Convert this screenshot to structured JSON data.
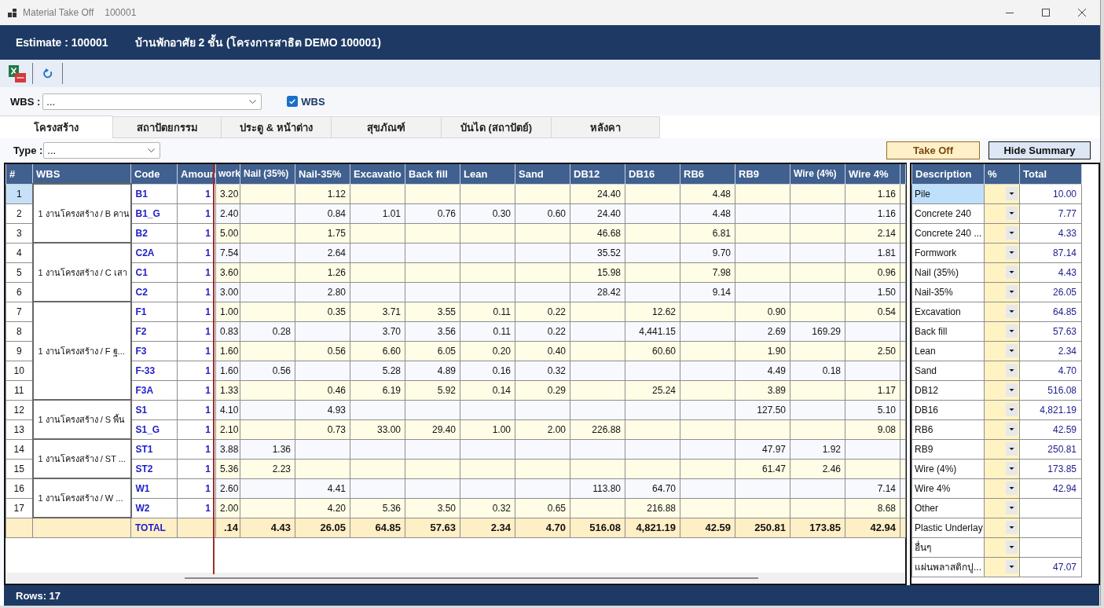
{
  "window": {
    "title": "Material Take Off",
    "document_number": "100001"
  },
  "header": {
    "estimate": "Estimate : 100001",
    "project": "บ้านพักอาศัย 2 ชั้น (โครงการสาธิต DEMO 100001)"
  },
  "filter": {
    "label": "WBS :",
    "value": "...",
    "checkbox": {
      "label": "WBS",
      "checked": true
    }
  },
  "tabs": [
    {
      "label": "โครงสร้าง",
      "selected": true
    },
    {
      "label": "สถาปัตยกรรม",
      "selected": false
    },
    {
      "label": "ประตู & หน้าต่าง",
      "selected": false
    },
    {
      "label": "สุขภัณฑ์",
      "selected": false
    },
    {
      "label": "บันได (สถาปัตย์)",
      "selected": false
    },
    {
      "label": "หลังคา",
      "selected": false
    }
  ],
  "type_filter": {
    "label": "Type :",
    "value": "..."
  },
  "actions": [
    {
      "label": "Take Off",
      "kind": "accent"
    },
    {
      "label": "Hide Summary",
      "kind": "plain"
    }
  ],
  "table": {
    "columns": [
      "#",
      "WBS",
      "Code",
      "Amoun",
      "work",
      "Nail (35%)",
      "Nail-35%",
      "Excavatio",
      "Back fill",
      "Lean",
      "Sand",
      "DB12",
      "DB16",
      "RB6",
      "RB9",
      "Wire (4%)",
      "Wire 4%"
    ],
    "groups": [
      {
        "wbs": "1 งานโครงสร้าง / B คาน",
        "rows": [
          {
            "number": "1",
            "selected": true,
            "code": "B1",
            "amount": "1",
            "quantities": {
              "column_5": "3.20",
              "nail_35": "1.12",
              "db12": "24.40",
              "rb6": "4.48",
              "wire_4": "1.16"
            }
          },
          {
            "number": "2",
            "selected": false,
            "code": "B1_G",
            "amount": "1",
            "quantities": {
              "column_5": "2.40",
              "nail_35": "0.84",
              "excavation": "1.01",
              "back_fill": "0.76",
              "lean": "0.30",
              "sand": "0.60",
              "db12": "24.40",
              "rb6": "4.48",
              "wire_4": "1.16"
            }
          },
          {
            "number": "3",
            "selected": false,
            "code": "B2",
            "amount": "1",
            "quantities": {
              "column_5": "5.00",
              "nail_35": "1.75",
              "db12": "46.68",
              "rb6": "6.81",
              "wire_4": "2.14"
            }
          }
        ]
      },
      {
        "wbs": "1 งานโครงสร้าง / C เสา",
        "rows": [
          {
            "number": "4",
            "selected": false,
            "code": "C2A",
            "amount": "1",
            "quantities": {
              "column_5": "7.54",
              "nail_35": "2.64",
              "db12": "35.52",
              "rb6": "9.70",
              "wire_4": "1.81"
            }
          },
          {
            "number": "5",
            "selected": false,
            "code": "C1",
            "amount": "1",
            "quantities": {
              "column_5": "3.60",
              "nail_35": "1.26",
              "db12": "15.98",
              "rb6": "7.98",
              "wire_4": "0.96"
            }
          },
          {
            "number": "6",
            "selected": false,
            "code": "C2",
            "amount": "1",
            "quantities": {
              "column_5": "3.00",
              "nail_35": "2.80",
              "db12": "28.42",
              "rb6": "9.14",
              "wire_4": "1.50"
            }
          }
        ]
      },
      {
        "wbs": "1 งานโครงสร้าง / F ฐ...",
        "rows": [
          {
            "number": "7",
            "selected": false,
            "code": "F1",
            "amount": "1",
            "quantities": {
              "column_5": "1.00",
              "nail_35": "0.35",
              "excavation": "3.71",
              "back_fill": "3.55",
              "lean": "0.11",
              "sand": "0.22",
              "db16": "12.62",
              "rb9": "0.90",
              "wire_4": "0.54"
            }
          },
          {
            "number": "8",
            "selected": false,
            "code": "F2",
            "amount": "1",
            "quantities": {
              "column_5": "0.83",
              "nail_35_bracketed": "0.28",
              "excavation": "3.70",
              "back_fill": "3.56",
              "lean": "0.11",
              "sand": "0.22",
              "db16": "4,441.15",
              "rb9": "2.69",
              "wire_4_bracketed": "169.29"
            }
          },
          {
            "number": "9",
            "selected": false,
            "code": "F3",
            "amount": "1",
            "quantities": {
              "column_5": "1.60",
              "nail_35": "0.56",
              "excavation": "6.60",
              "back_fill": "6.05",
              "lean": "0.20",
              "sand": "0.40",
              "db16": "60.60",
              "rb9": "1.90",
              "wire_4": "2.50"
            }
          },
          {
            "number": "10",
            "selected": false,
            "code": "F-33",
            "amount": "1",
            "quantities": {
              "column_5": "1.60",
              "nail_35_bracketed": "0.56",
              "excavation": "5.28",
              "back_fill": "4.89",
              "lean": "0.16",
              "sand": "0.32",
              "rb9": "4.49",
              "wire_4_bracketed": "0.18"
            }
          },
          {
            "number": "11",
            "selected": false,
            "code": "F3A",
            "amount": "1",
            "quantities": {
              "column_5": "1.33",
              "nail_35": "0.46",
              "excavation": "6.19",
              "back_fill": "5.92",
              "lean": "0.14",
              "sand": "0.29",
              "db16": "25.24",
              "rb9": "3.89",
              "wire_4": "1.17"
            }
          }
        ]
      },
      {
        "wbs": "1 งานโครงสร้าง / S พื้น",
        "rows": [
          {
            "number": "12",
            "selected": false,
            "code": "S1",
            "amount": "1",
            "quantities": {
              "column_5": "4.10",
              "nail_35": "4.93",
              "rb9": "127.50",
              "wire_4": "5.10"
            }
          },
          {
            "number": "13",
            "selected": false,
            "code": "S1_G",
            "amount": "1",
            "quantities": {
              "column_5": "2.10",
              "nail_35": "0.73",
              "excavation": "33.00",
              "back_fill": "29.40",
              "lean": "1.00",
              "sand": "2.00",
              "db12": "226.88",
              "wire_4": "9.08"
            }
          }
        ]
      },
      {
        "wbs": "1 งานโครงสร้าง / ST ...",
        "rows": [
          {
            "number": "14",
            "selected": false,
            "code": "ST1",
            "amount": "1",
            "quantities": {
              "column_5": "3.88",
              "nail_35_bracketed": "1.36",
              "rb9": "47.97",
              "wire_4_bracketed": "1.92"
            }
          },
          {
            "number": "15",
            "selected": false,
            "code": "ST2",
            "amount": "1",
            "quantities": {
              "column_5": "5.36",
              "nail_35_bracketed": "2.23",
              "rb9": "61.47",
              "wire_4_bracketed": "2.46"
            }
          }
        ]
      },
      {
        "wbs": "1 งานโครงสร้าง / W ...",
        "rows": [
          {
            "number": "16",
            "selected": false,
            "code": "W1",
            "amount": "1",
            "quantities": {
              "column_5": "2.60",
              "nail_35": "4.41",
              "db12": "113.80",
              "db16": "64.70",
              "wire_4": "7.14"
            }
          },
          {
            "number": "17",
            "selected": false,
            "code": "W2",
            "amount": "1",
            "quantities": {
              "column_5": "2.00",
              "nail_35": "4.20",
              "excavation": "5.36",
              "back_fill": "3.50",
              "lean": "0.32",
              "sand": "0.65",
              "db16": "216.88",
              "wire_4": "8.68"
            }
          }
        ]
      }
    ],
    "total": {
      "label": "TOTAL",
      "quantities": {
        "column_5": ".14",
        "nail_35_bracketed": "4.43",
        "nail_35": "26.05",
        "excavation": "64.85",
        "back_fill": "57.63",
        "lean": "2.34",
        "sand": "4.70",
        "db12": "516.08",
        "db16": "4,821.19",
        "rb6": "42.59",
        "rb9": "250.81",
        "wire_4_bracketed": "173.85",
        "wire_4": "42.94"
      }
    }
  },
  "summary": {
    "columns": [
      "Description",
      "%",
      "Total"
    ],
    "rows": [
      {
        "description": "Pile",
        "selected": true,
        "total": "10.00"
      },
      {
        "description": "Concrete 240",
        "selected": false,
        "total": "7.77"
      },
      {
        "description": "Concrete 240 ...",
        "selected": false,
        "total": "4.33"
      },
      {
        "description": "Formwork",
        "selected": false,
        "total": "87.14"
      },
      {
        "description": "Nail (35%)",
        "selected": false,
        "total": "4.43"
      },
      {
        "description": "Nail-35%",
        "selected": false,
        "total": "26.05"
      },
      {
        "description": "Excavation",
        "selected": false,
        "total": "64.85"
      },
      {
        "description": "Back fill",
        "selected": false,
        "total": "57.63"
      },
      {
        "description": "Lean",
        "selected": false,
        "total": "2.34"
      },
      {
        "description": "Sand",
        "selected": false,
        "total": "4.70"
      },
      {
        "description": "DB12",
        "selected": false,
        "total": "516.08"
      },
      {
        "description": "DB16",
        "selected": false,
        "total": "4,821.19"
      },
      {
        "description": "RB6",
        "selected": false,
        "total": "42.59"
      },
      {
        "description": "RB9",
        "selected": false,
        "total": "250.81"
      },
      {
        "description": "Wire (4%)",
        "selected": false,
        "total": "173.85"
      },
      {
        "description": "Wire 4%",
        "selected": false,
        "total": "42.94"
      },
      {
        "description": "Other",
        "selected": false
      },
      {
        "description": "Plastic Underlay",
        "selected": false
      },
      {
        "description": "อื่นๆ",
        "selected": false
      },
      {
        "description": "แผ่นพลาสติกปู...",
        "selected": false,
        "total": "47.07"
      }
    ]
  },
  "status_bar": {
    "text": "Rows: 17"
  }
}
